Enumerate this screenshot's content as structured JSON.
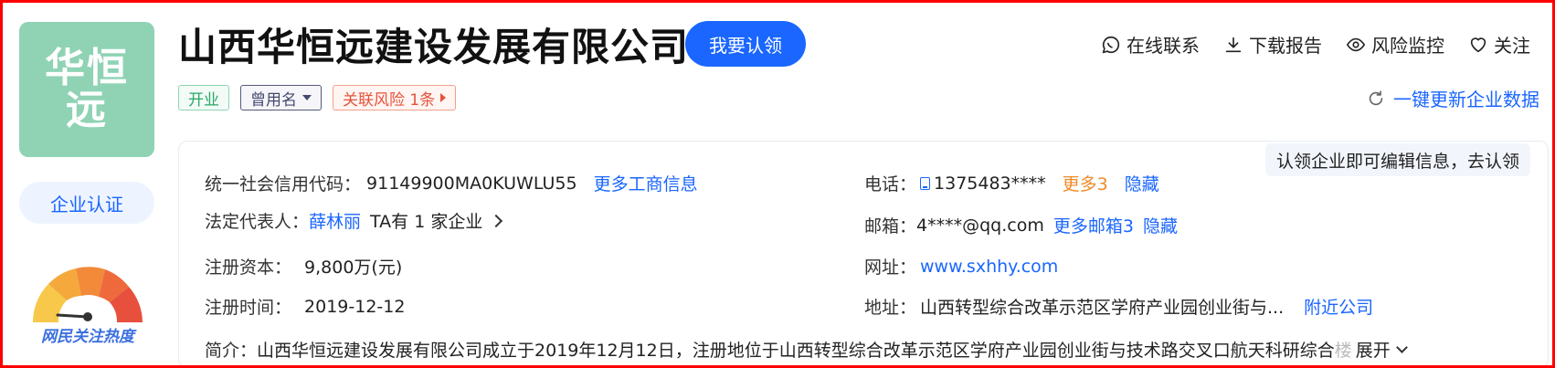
{
  "logo": {
    "line1": "华恒",
    "line2": "远"
  },
  "certify_label": "企业认证",
  "heat_label": "网民关注热度",
  "company_name": "山西华恒远建设发展有限公司",
  "claim_label": "我要认领",
  "actions": [
    {
      "label": "在线联系",
      "icon": "chat-icon"
    },
    {
      "label": "下载报告",
      "icon": "download-icon"
    },
    {
      "label": "风险监控",
      "icon": "eye-icon"
    },
    {
      "label": "关注",
      "icon": "heart-icon"
    }
  ],
  "tags": {
    "status": "开业",
    "former_name": "曾用名",
    "risk": "关联风险 1条"
  },
  "update_label": "一键更新企业数据",
  "tip": "认领企业即可编辑信息，去认领",
  "info": {
    "credit_code_label": "统一社会信用代码：",
    "credit_code": "91149900MA0KUWLU55",
    "more_business": "更多工商信息",
    "legal_rep_label": "法定代表人：",
    "legal_rep": "薛林丽",
    "legal_rep_companies": "TA有 1 家企业",
    "capital_label": "注册资本：",
    "capital": "9,800万(元)",
    "reg_date_label": "注册时间：",
    "reg_date": "2019-12-12",
    "phone_label": "电话：",
    "phone": "1375483****",
    "phone_more": "更多3",
    "phone_hide": "隐藏",
    "email_label": "邮箱：",
    "email": "4****@qq.com",
    "email_more": "更多邮箱3",
    "email_hide": "隐藏",
    "website_label": "网址：",
    "website": "www.sxhhy.com",
    "address_label": "地址：",
    "address": "山西转型综合改革示范区学府产业园创业街与...",
    "nearby": "附近公司",
    "intro_label": "简介：",
    "intro": "山西华恒远建设发展有限公司成立于2019年12月12日，注册地位于山西转型综合改革示范区学府产业园创业街与技术路交叉口航天科研综合",
    "intro_fade": "楼",
    "expand": "展开"
  },
  "colors": {
    "brand_blue": "#1a66ff",
    "logo_green": "#8fd3b4",
    "risk_red": "#e5533a",
    "more_orange": "#f08a28",
    "frame_red": "#ff0000"
  }
}
